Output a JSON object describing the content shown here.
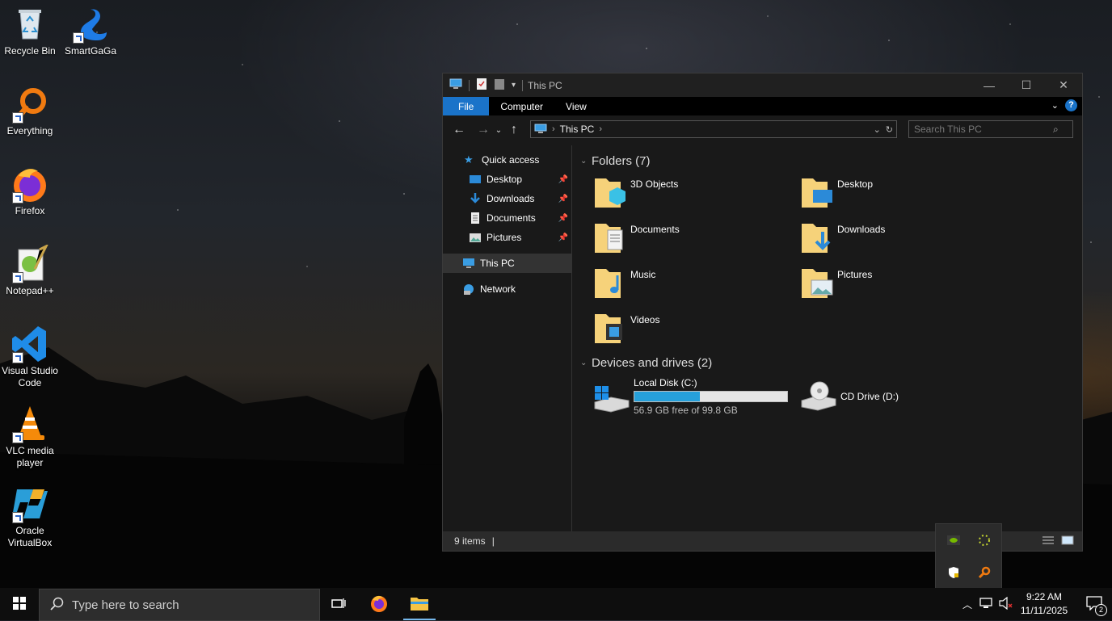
{
  "desktop": {
    "icons": [
      {
        "label": "Recycle Bin",
        "icon": "recycle-bin-icon"
      },
      {
        "label": "SmartGaGa",
        "icon": "smartgaga-swan-icon"
      },
      {
        "label": "Everything",
        "icon": "everything-magnifier-icon"
      },
      {
        "label": "Firefox",
        "icon": "firefox-icon"
      },
      {
        "label": "Notepad++",
        "icon": "notepad-plus-plus-icon"
      },
      {
        "label": "Visual Studio Code",
        "icon": "vscode-icon"
      },
      {
        "label": "VLC media player",
        "icon": "vlc-cone-icon"
      },
      {
        "label": "Oracle VirtualBox",
        "icon": "virtualbox-icon"
      }
    ]
  },
  "explorer": {
    "title": "This PC",
    "window_buttons": {
      "minimize": "—",
      "maximize": "☐",
      "close": "✕"
    },
    "ribbon_tabs": [
      "File",
      "Computer",
      "View"
    ],
    "help": "?",
    "address": {
      "crumb": "This PC"
    },
    "search": {
      "placeholder": "Search This PC"
    },
    "nav_pane": {
      "quick_access": "Quick access",
      "quick_items": [
        "Desktop",
        "Downloads",
        "Documents",
        "Pictures"
      ],
      "this_pc": "This PC",
      "network": "Network"
    },
    "folders_header": "Folders (7)",
    "folders": [
      "3D Objects",
      "Desktop",
      "Documents",
      "Downloads",
      "Music",
      "Pictures",
      "Videos"
    ],
    "drives_header": "Devices and drives (2)",
    "drives": [
      {
        "name": "Local Disk (C:)",
        "free_text": "56.9 GB free of 99.8 GB",
        "used_fraction": 0.43
      },
      {
        "name": "CD Drive (D:)"
      }
    ],
    "status": {
      "count": "9 items",
      "divider": "|"
    }
  },
  "taskbar": {
    "search_placeholder": "Type here to search",
    "time": "9:22 AM",
    "date": "11/11/2025",
    "notification_count": "2"
  },
  "colors": {
    "accent": "#1a73c9",
    "drive_fill": "#26a0da",
    "taskbar": "#0e0e0e"
  }
}
